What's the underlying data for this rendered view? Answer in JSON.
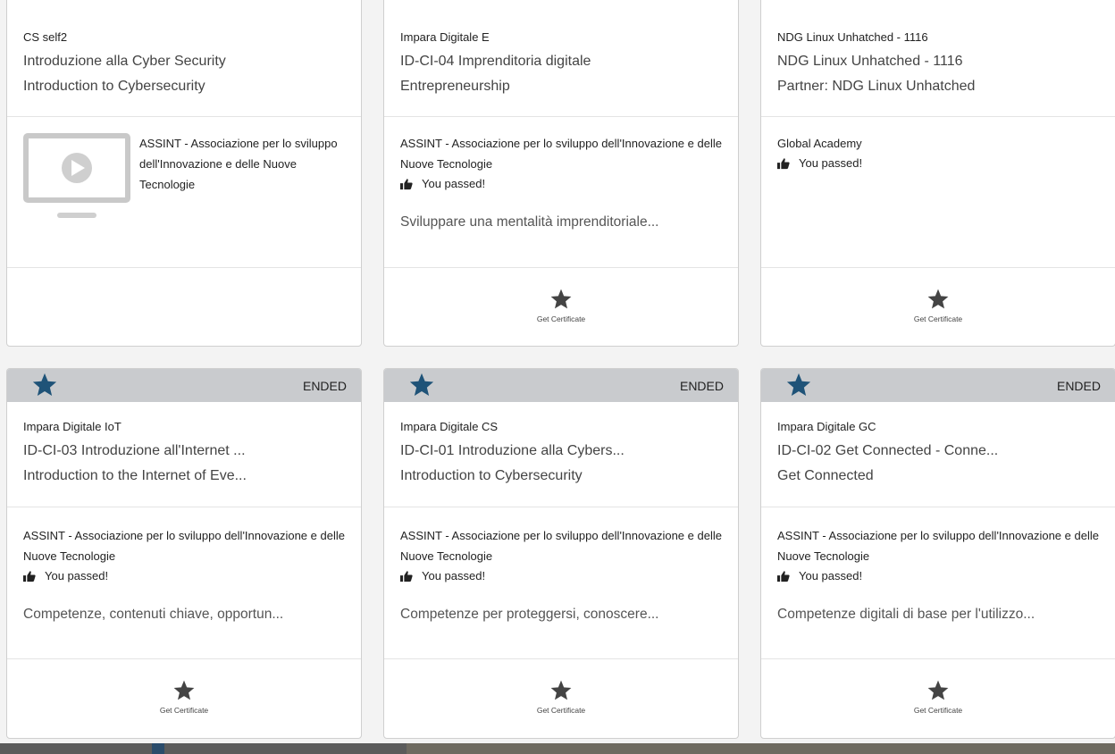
{
  "colors": {
    "header_bg": "#c9cbce",
    "star_accent": "#1f5378",
    "card_bg": "#ffffff"
  },
  "icons": {
    "thumb": "thumbs-up-icon",
    "star": "star-icon",
    "video": "video-placeholder-icon"
  },
  "cards": [
    {
      "line1": "CS self2",
      "line2": "Introduzione alla Cyber Security",
      "line3": "Introduction to Cybersecurity",
      "org": "ASSINT - Associazione per lo sviluppo dell'Innovazione e delle Nuove Tecnologie"
    },
    {
      "line1": "Impara Digitale E",
      "line2": "ID-CI-04 Imprenditoria digitale",
      "line3": "Entrepreneurship",
      "org": "ASSINT - Associazione per lo sviluppo dell'Innovazione e delle Nuove Tecnologie",
      "passed": "You passed!",
      "desc": "Sviluppare una mentalità imprenditoriale...",
      "cert": "Get Certificate"
    },
    {
      "line1": "NDG Linux Unhatched - 1116",
      "line2": "NDG Linux Unhatched - 1116",
      "line3": "Partner: NDG Linux Unhatched",
      "org": "Global Academy",
      "passed": "You passed!",
      "cert": "Get Certificate"
    },
    {
      "status": "ENDED",
      "line1": "Impara Digitale IoT",
      "line2": "ID-CI-03 Introduzione all'Internet ...",
      "line3": "Introduction to the Internet of Eve...",
      "org": "ASSINT - Associazione per lo sviluppo dell'Innovazione e delle Nuove Tecnologie",
      "passed": "You passed!",
      "desc": "Competenze, contenuti chiave, opportun...",
      "cert": "Get Certificate"
    },
    {
      "status": "ENDED",
      "line1": "Impara Digitale CS",
      "line2": "ID-CI-01 Introduzione alla Cybers...",
      "line3": "Introduction to Cybersecurity",
      "org": "ASSINT - Associazione per lo sviluppo dell'Innovazione e delle Nuove Tecnologie",
      "passed": "You passed!",
      "desc": "Competenze per proteggersi, conoscere...",
      "cert": "Get Certificate"
    },
    {
      "status": "ENDED",
      "line1": "Impara Digitale GC",
      "line2": "ID-CI-02 Get Connected - Conne...",
      "line3": "Get Connected",
      "org": "ASSINT - Associazione per lo sviluppo dell'Innovazione e delle Nuove Tecnologie",
      "passed": "You passed!",
      "desc": "Competenze digitali di base per l'utilizzo...",
      "cert": "Get Certificate"
    }
  ]
}
